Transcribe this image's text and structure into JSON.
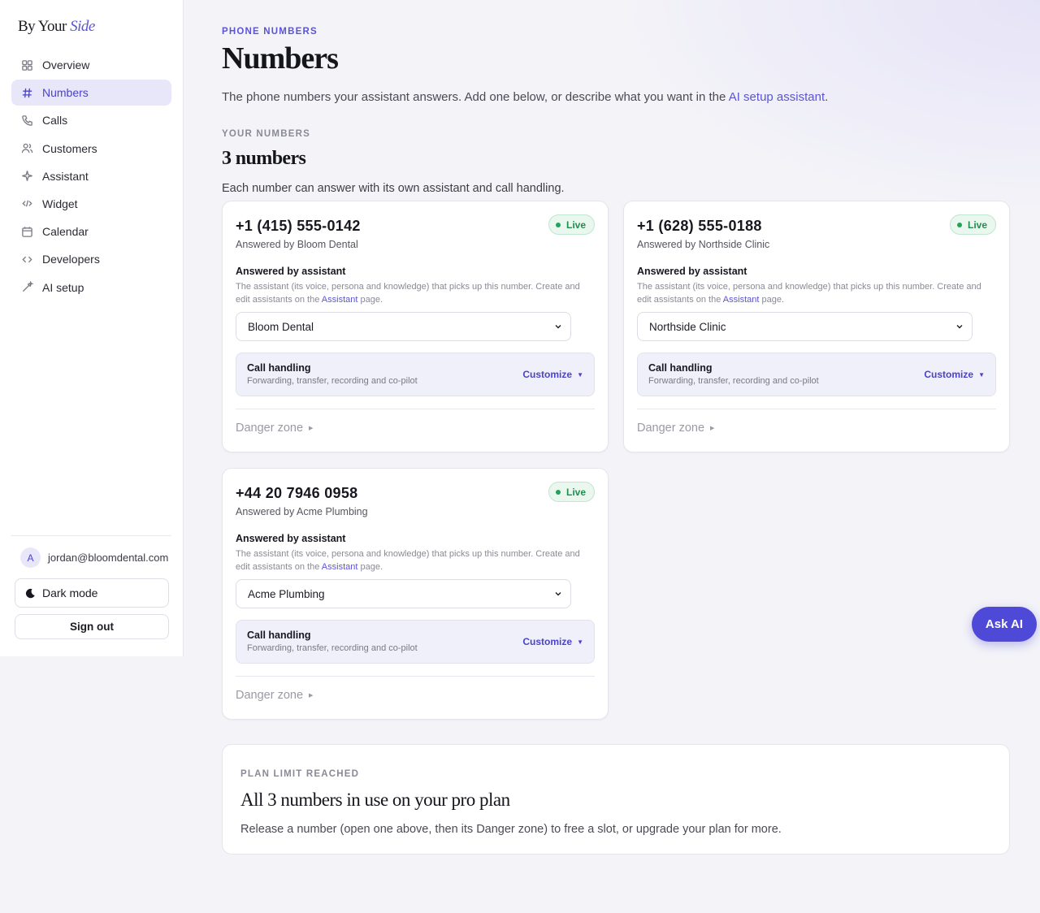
{
  "brand": {
    "prefix": "By Your",
    "accent": "Side"
  },
  "sidebar": {
    "items": [
      {
        "label": "Overview",
        "icon": "grid-icon"
      },
      {
        "label": "Numbers",
        "icon": "hash-icon",
        "active": true
      },
      {
        "label": "Calls",
        "icon": "phone-icon"
      },
      {
        "label": "Customers",
        "icon": "users-icon"
      },
      {
        "label": "Assistant",
        "icon": "sparkle-icon"
      },
      {
        "label": "Widget",
        "icon": "code-icon"
      },
      {
        "label": "Calendar",
        "icon": "calendar-icon"
      },
      {
        "label": "Developers",
        "icon": "brackets-icon"
      },
      {
        "label": "AI setup",
        "icon": "wand-icon"
      }
    ],
    "user": {
      "initial": "A",
      "email": "jordan@bloomdental.com"
    },
    "dark_mode_label": "Dark mode",
    "sign_out_label": "Sign out"
  },
  "header": {
    "eyebrow": "PHONE NUMBERS",
    "title": "Numbers",
    "intro_text": "The phone numbers your assistant answers. Add one below, or describe what you want in the",
    "intro_link": "AI setup assistant",
    "intro_end": "."
  },
  "numbers_section": {
    "eyebrow": "YOUR NUMBERS",
    "count": "3 numbers",
    "subtitle": "Each number can answer with its own assistant and call handling."
  },
  "cards": [
    {
      "number": "+1 (415) 555-0142",
      "owner": "Answered by Bloom Dental",
      "status": "Live",
      "assistant_label": "Answered by assistant",
      "desc_text": "The assistant (its voice, persona and knowledge) that picks up this number. Create and edit assistants on the",
      "desc_link": "Assistant",
      "desc_end": "page.",
      "selected_assistant": "Bloom Dental",
      "handling_title": "Call handling",
      "handling_sub": "Forwarding, transfer, recording and co-pilot",
      "customize_label": "Customize",
      "danger_label": "Danger zone"
    },
    {
      "number": "+1 (628) 555-0188",
      "owner": "Answered by Northside Clinic",
      "status": "Live",
      "assistant_label": "Answered by assistant",
      "desc_text": "The assistant (its voice, persona and knowledge) that picks up this number. Create and edit assistants on the",
      "desc_link": "Assistant",
      "desc_end": "page.",
      "selected_assistant": "Northside Clinic",
      "handling_title": "Call handling",
      "handling_sub": "Forwarding, transfer, recording and co-pilot",
      "customize_label": "Customize",
      "danger_label": "Danger zone"
    },
    {
      "number": "+44 20 7946 0958",
      "owner": "Answered by Acme Plumbing",
      "status": "Live",
      "assistant_label": "Answered by assistant",
      "desc_text": "The assistant (its voice, persona and knowledge) that picks up this number. Create and edit assistants on the",
      "desc_link": "Assistant",
      "desc_end": "page.",
      "selected_assistant": "Acme Plumbing",
      "handling_title": "Call handling",
      "handling_sub": "Forwarding, transfer, recording and co-pilot",
      "customize_label": "Customize",
      "danger_label": "Danger zone"
    }
  ],
  "plan_limit": {
    "eyebrow": "PLAN LIMIT REACHED",
    "title": "All 3 numbers in use on your pro plan",
    "description": "Release a number (open one above, then its Danger zone) to free a slot, or upgrade your plan for more."
  },
  "ask_ai_label": "Ask AI",
  "colors": {
    "accent": "#5b55d6",
    "live": "#1f8f4e",
    "background": "#f3f3f8"
  }
}
